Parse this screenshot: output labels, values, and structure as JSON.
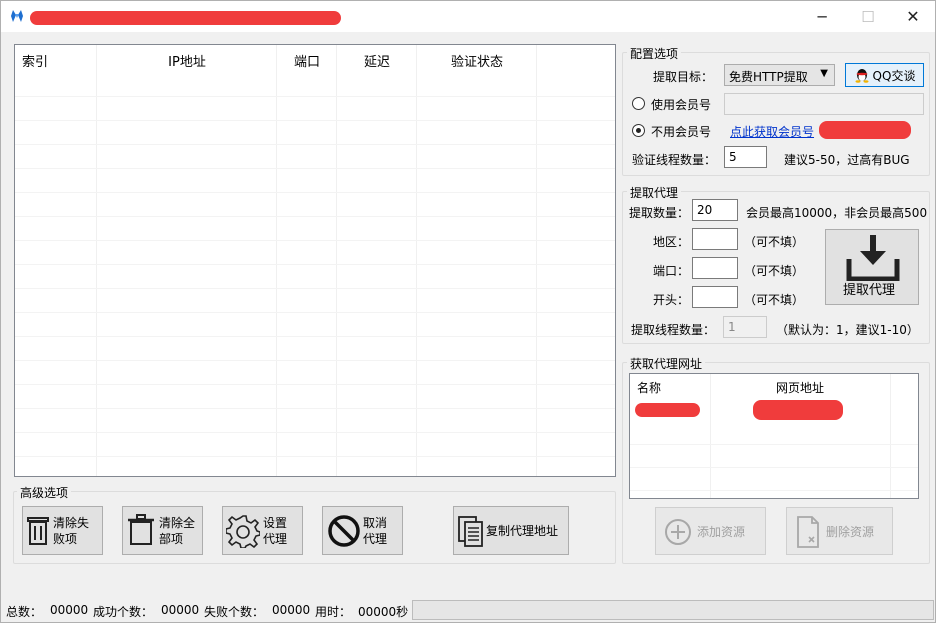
{
  "window": {
    "min": "─",
    "max": "☐",
    "close": "✕"
  },
  "proxy_table": {
    "columns": [
      "索引",
      "IP地址",
      "端口",
      "延迟",
      "验证状态"
    ],
    "rows": []
  },
  "config": {
    "title": "配置选项",
    "target_label": "提取目标：",
    "target_value": "免费HTTP提取",
    "qq_button": "QQ交谈",
    "use_member_label": "使用会员号",
    "member_input": "",
    "no_member_label": "不用会员号",
    "get_member_link": "点此获取会员号",
    "threads_label": "验证线程数量：",
    "threads_value": "5",
    "threads_hint": "建议5-50，过高有BUG"
  },
  "extract": {
    "title": "提取代理",
    "count_label": "提取数量：",
    "count_value": "20",
    "count_hint": "会员最高10000，非会员最高500",
    "region_label": "地区：",
    "port_label": "端口：",
    "prefix_label": "开头：",
    "optional_hint": "（可不填）",
    "button": "提取代理",
    "threads_label": "提取线程数量：",
    "threads_value": "1",
    "threads_hint": "（默认为：1，建议1-10）"
  },
  "sources": {
    "title": "获取代理网址",
    "columns": [
      "名称",
      "网页地址"
    ],
    "add_button": "添加资源",
    "delete_button": "删除资源"
  },
  "advanced": {
    "title": "高级选项",
    "clear_failed": "清除失败项",
    "clear_all": "清除全部项",
    "set_proxy": "设置代理",
    "cancel_proxy": "取消代理",
    "copy_address": "复制代理地址"
  },
  "status": {
    "total_label": "总数：",
    "total_value": "00000",
    "success_label": "成功个数：",
    "success_value": "00000",
    "fail_label": "失败个数：",
    "fail_value": "00000",
    "time_label": "用时：",
    "time_value": "00000秒"
  },
  "colors": {
    "accent_link": "#0033cc",
    "redaction": "#f03c3c"
  }
}
